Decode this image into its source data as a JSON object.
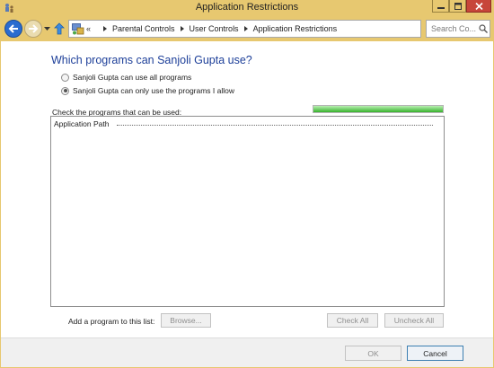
{
  "window": {
    "title": "Application Restrictions",
    "title_bar_color": "#e7c870",
    "close_button_color": "#c7463a"
  },
  "nav": {
    "back_icon": "back-arrow-icon",
    "forward_icon": "forward-arrow-icon",
    "up_icon": "up-arrow-icon",
    "overflow": "«",
    "breadcrumbs": [
      "Parental Controls",
      "User Controls",
      "Application Restrictions"
    ],
    "search_placeholder": "Search Co..."
  },
  "main": {
    "heading": "Which programs can Sanjoli Gupta use?",
    "heading_color": "#1d3f99",
    "options": [
      {
        "label": "Sanjoli Gupta can use all programs",
        "selected": false
      },
      {
        "label": "Sanjoli Gupta can only use the programs I allow",
        "selected": true
      }
    ],
    "list_label": "Check the programs that can be used:",
    "progress_fraction": 1.0,
    "list_column_header": "Application Path",
    "add_program_label": "Add a program to this list:",
    "browse_label": "Browse...",
    "check_all_label": "Check All",
    "uncheck_all_label": "Uncheck All"
  },
  "footer": {
    "ok_label": "OK",
    "cancel_label": "Cancel"
  }
}
